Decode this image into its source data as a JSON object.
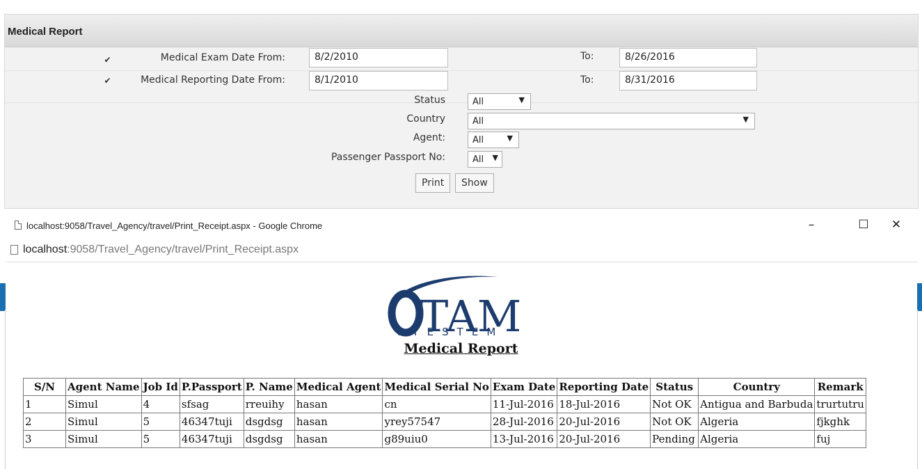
{
  "form": {
    "title": "Medical Report",
    "exam_date_from_label": "Medical Exam Date From:",
    "exam_date_from": "8/2/2010",
    "exam_to_label": "To:",
    "exam_date_to": "8/26/2016",
    "reporting_date_from_label": "Medical Reporting Date From:",
    "reporting_date_from": "8/1/2010",
    "reporting_to_label": "To:",
    "reporting_date_to": "8/31/2016",
    "status_label": "Status",
    "status_value": "All",
    "country_label": "Country",
    "country_value": "All",
    "agent_label": "Agent:",
    "agent_value": "All",
    "passport_label": "Passenger Passport No:",
    "passport_value": "All",
    "print_label": "Print",
    "show_label": "Show"
  },
  "popup": {
    "window_title": "localhost:9058/Travel_Agency/travel/Print_Receipt.aspx - Google Chrome",
    "url_host": "localhost",
    "url_path": ":9058/Travel_Agency/travel/Print_Receipt.aspx",
    "logo_main": "TAM",
    "logo_sub": "SYESTEM",
    "report_title": "Medical Report",
    "table": {
      "headers": [
        "S/N",
        "Agent Name",
        "Job Id",
        "P.Passport",
        "P. Name",
        "Medical Agent",
        "Medical Serial No",
        "Exam Date",
        "Reporting Date",
        "Status",
        "Country",
        "Remark"
      ],
      "rows": [
        [
          "1",
          "Simul",
          "4",
          "sfsag",
          "rreuihy",
          "hasan",
          "cn",
          "11-Jul-2016",
          "18-Jul-2016",
          "Not OK",
          "Antigua and Barbuda",
          "trurtutru"
        ],
        [
          "2",
          "Simul",
          "5",
          "46347tuji",
          "dsgdsg",
          "hasan",
          "yrey57547",
          "28-Jul-2016",
          "20-Jul-2016",
          "Not OK",
          "Algeria",
          "fjkghk"
        ],
        [
          "3",
          "Simul",
          "5",
          "46347tuji",
          "dsgdsg",
          "hasan",
          "g89uiu0",
          "13-Jul-2016",
          "20-Jul-2016",
          "Pending",
          "Algeria",
          "fuj"
        ]
      ]
    }
  },
  "colors": {
    "accent_blue": "#1a6fb0",
    "logo_navy": "#1d3c6e",
    "logo_red": "#d12d2d"
  }
}
